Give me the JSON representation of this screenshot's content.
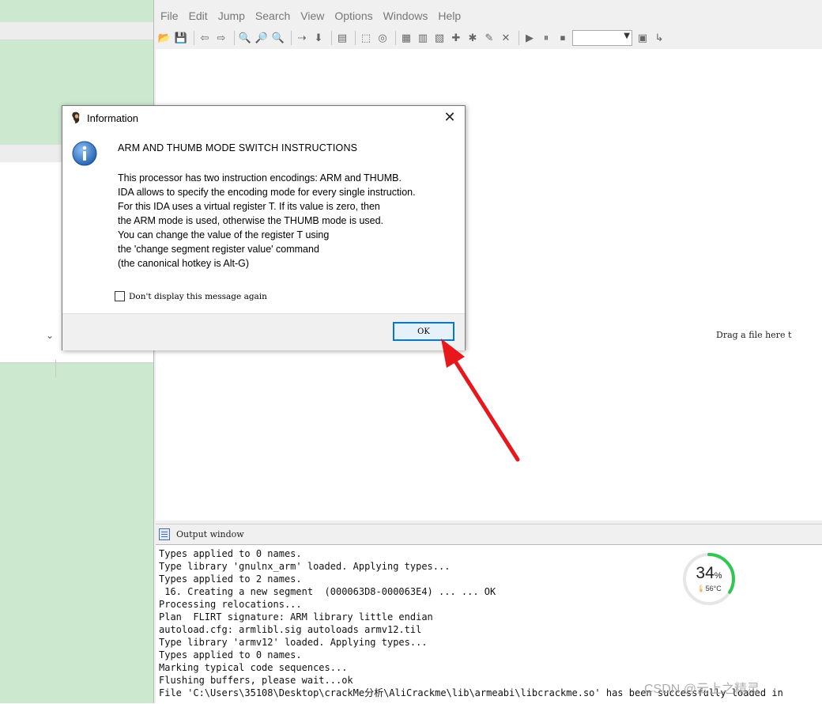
{
  "menu": [
    "File",
    "Edit",
    "Jump",
    "Search",
    "View",
    "Options",
    "Windows",
    "Help"
  ],
  "toolbar_icons": [
    "open-icon",
    "save-icon",
    "sep",
    "back-icon",
    "forward-icon",
    "sep",
    "find-text-icon",
    "find-binary-icon",
    "find-imm-icon",
    "sep",
    "find-next-icon",
    "down-icon",
    "sep",
    "graph-icon",
    "sep",
    "hex-icon",
    "disk-icon",
    "sep",
    "structs-icon",
    "enums-icon",
    "names-icon",
    "add-icon",
    "debug-icon",
    "edit-icon",
    "close-x-icon",
    "sep",
    "play-icon",
    "pause-icon",
    "stop-icon"
  ],
  "toolbar_icons_end": [
    "attach-icon",
    "step-icon"
  ],
  "workarea": {
    "drag_hint": "Drag a file here t"
  },
  "output": {
    "title": "Output window",
    "lines": [
      "Types applied to 0 names.",
      "Type library 'gnulnx_arm' loaded. Applying types...",
      "Types applied to 2 names.",
      " 16. Creating a new segment  (000063D8-000063E4) ... ... OK",
      "Processing relocations...",
      "Plan  FLIRT signature: ARM library little endian",
      "autoload.cfg: armlibl.sig autoloads armv12.til",
      "Type library 'armv12' loaded. Applying types...",
      "Types applied to 0 names.",
      "Marking typical code sequences...",
      "Flushing buffers, please wait...ok",
      "File 'C:\\Users\\35108\\Desktop\\crackMe分析\\AliCrackme\\lib\\armeabi\\libcrackme.so' has been successfully loaded in"
    ]
  },
  "gauge": {
    "percent": "34",
    "percent_unit": "%",
    "percent_value": 34,
    "temp": "56°C",
    "color": "#2fc652"
  },
  "watermark": "CSDN @云上之精灵",
  "dialog": {
    "title": "Information",
    "heading": "ARM AND THUMB MODE SWITCH INSTRUCTIONS",
    "lines": [
      "This processor has two instruction encodings: ARM and THUMB.",
      "IDA allows to specify the encoding mode for every single instruction.",
      "For this IDA uses a virtual register T. If its value is zero, then",
      "the ARM mode is used, otherwise the THUMB mode is used.",
      "You can change the value of the register T using",
      "the 'change segment register value' command",
      "(the canonical hotkey is Alt-G)"
    ],
    "checkbox_label": "Don't display this message again",
    "checkbox_checked": false,
    "ok_label": "OK",
    "close_glyph": "✕"
  },
  "annotation": {
    "color": "#e8171c"
  }
}
